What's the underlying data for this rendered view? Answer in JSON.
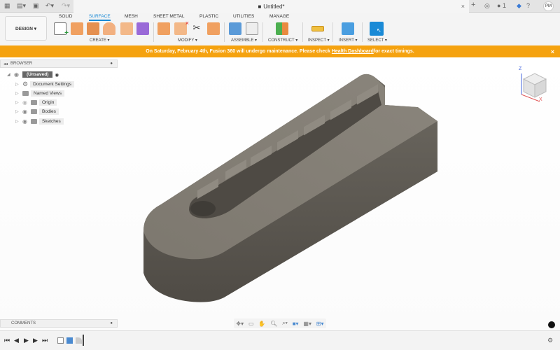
{
  "window": {
    "title": "Untitled*",
    "close": "×",
    "new_tab": "+",
    "job_count": "1",
    "user_initials": "PM"
  },
  "tabs": [
    {
      "label": "SOLID"
    },
    {
      "label": "SURFACE",
      "active": true
    },
    {
      "label": "MESH"
    },
    {
      "label": "SHEET METAL"
    },
    {
      "label": "PLASTIC"
    },
    {
      "label": "UTILITIES"
    },
    {
      "label": "MANAGE"
    }
  ],
  "workspace": "DESIGN ▾",
  "groups": {
    "create": "CREATE ▾",
    "modify": "MODIFY ▾",
    "assemble": "ASSEMBLE ▾",
    "construct": "CONSTRUCT ▾",
    "inspect": "INSPECT ▾",
    "insert": "INSERT ▾",
    "select": "SELECT ▾"
  },
  "banner": {
    "text": "On Saturday, February 4th, Fusion 360 will undergo maintenance. Please check ",
    "link": "Health Dashboard",
    "suffix": " for exact timings."
  },
  "browser": {
    "title": "BROWSER",
    "root": "(Unsaved)",
    "items": [
      {
        "label": "Document Settings"
      },
      {
        "label": "Named Views"
      },
      {
        "label": "Origin"
      },
      {
        "label": "Bodies"
      },
      {
        "label": "Sketches"
      }
    ]
  },
  "comments": {
    "title": "COMMENTS"
  },
  "viewcube": {
    "z": "Z",
    "x": "X"
  },
  "colors": {
    "accent": "#1a8ad6",
    "banner": "#f5a20f",
    "model": "#6b665e"
  }
}
